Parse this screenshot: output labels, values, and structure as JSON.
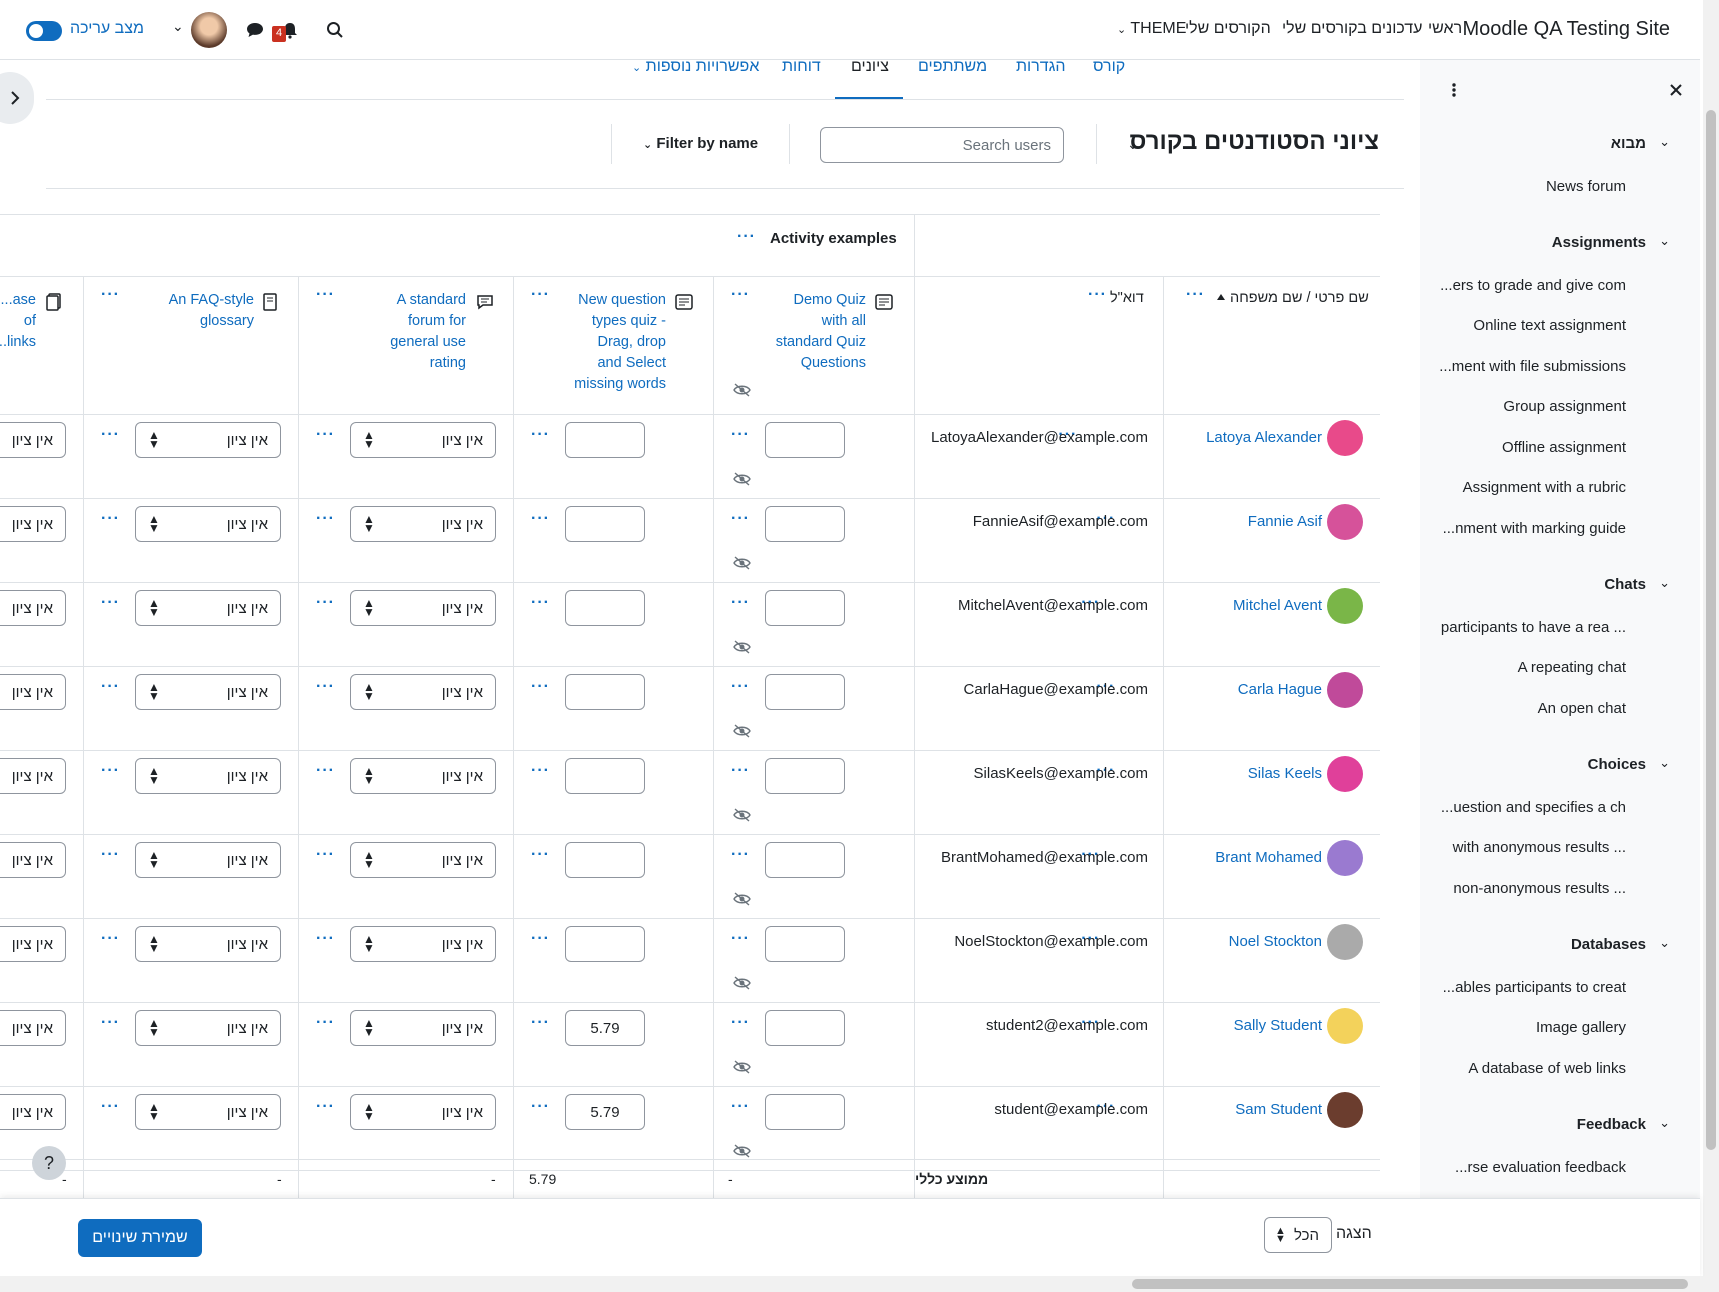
{
  "header": {
    "site_name": "Moodle QA Testing Site",
    "nav": [
      "ראשי",
      "עדכונים בקורסים שלי",
      "הקורסים שלי",
      "THEME"
    ],
    "notification_count": "4",
    "edit_mode_label": "מצב עריכה"
  },
  "tabs": [
    {
      "label": "קורס"
    },
    {
      "label": "הגדרות"
    },
    {
      "label": "משתתפים"
    },
    {
      "label": "ציונים"
    },
    {
      "label": "דוחות"
    },
    {
      "label": "אפשרויות נוספות"
    }
  ],
  "page": {
    "title": "ציוני הסטודנטים בקורס",
    "search_placeholder": "Search users",
    "filter_label": "Filter by name"
  },
  "grid": {
    "category_title": "Activity examples",
    "col_name": "שם פרטי / שם משפחה",
    "col_email": "דוא\"ל",
    "items": [
      {
        "name": "Demo Quiz with all standard Quiz Questions"
      },
      {
        "name": "New question types quiz - Drag, drop and Select missing words"
      },
      {
        "name": "A standard forum for general use rating"
      },
      {
        "name": "An FAQ-style glossary"
      },
      {
        "name": "...ase of ...links"
      }
    ],
    "rows": [
      {
        "name": "Latoya Alexander",
        "email": "LatoyaAlexander@example.com",
        "quiz1": "",
        "quiz2": "",
        "forum": "אין ציון",
        "glossary": "אין ציון",
        "db": "אין ציון"
      },
      {
        "name": "Fannie Asif",
        "email": "FannieAsif@example.com",
        "quiz1": "",
        "quiz2": "",
        "forum": "אין ציון",
        "glossary": "אין ציון",
        "db": "אין ציון"
      },
      {
        "name": "Mitchel Avent",
        "email": "MitchelAvent@example.com",
        "quiz1": "",
        "quiz2": "",
        "forum": "אין ציון",
        "glossary": "אין ציון",
        "db": "אין ציון"
      },
      {
        "name": "Carla Hague",
        "email": "CarlaHague@example.com",
        "quiz1": "",
        "quiz2": "",
        "forum": "אין ציון",
        "glossary": "אין ציון",
        "db": "אין ציון"
      },
      {
        "name": "Silas Keels",
        "email": "SilasKeels@example.com",
        "quiz1": "",
        "quiz2": "",
        "forum": "אין ציון",
        "glossary": "אין ציון",
        "db": "אין ציון"
      },
      {
        "name": "Brant Mohamed",
        "email": "BrantMohamed@example.com",
        "quiz1": "",
        "quiz2": "",
        "forum": "אין ציון",
        "glossary": "אין ציון",
        "db": "אין ציון"
      },
      {
        "name": "Noel Stockton",
        "email": "NoelStockton@example.com",
        "quiz1": "",
        "quiz2": "",
        "forum": "אין ציון",
        "glossary": "אין ציון",
        "db": "אין ציון"
      },
      {
        "name": "Sally Student",
        "email": "student2@example.com",
        "quiz1": "",
        "quiz2": "5.79",
        "forum": "אין ציון",
        "glossary": "אין ציון",
        "db": "אין ציון"
      },
      {
        "name": "Sam Student",
        "email": "student@example.com",
        "quiz1": "",
        "quiz2": "5.79",
        "forum": "אין ציון",
        "glossary": "אין ציון",
        "db": "אין ציון"
      }
    ],
    "avatar_colors": [
      "#e84a8a",
      "#d6529a",
      "#7ab648",
      "#c04a9a",
      "#e0409a",
      "#9a7ad0",
      "#aaaaaa",
      "#f3d25b",
      "#6b3d2e"
    ],
    "overall_average_label": "ממוצע כללי",
    "avg_quiz1": "-",
    "avg_quiz2": "5.79",
    "avg_forum": "-",
    "avg_glossary": "-",
    "avg_db": "-"
  },
  "footer": {
    "view_label": "הצגה",
    "view_value": "הכל",
    "save_label": "שמירת שינויים"
  },
  "drawer": {
    "sections": [
      {
        "title": "מבוא",
        "items": [
          "News forum"
        ]
      },
      {
        "title": "Assignments",
        "items": [
          "...ers to grade and give com",
          "Online text assignment",
          "...ment with file submissions",
          "Group assignment",
          "Offline assignment",
          "Assignment with a rubric",
          "...nment with marking guide"
        ]
      },
      {
        "title": "Chats",
        "items": [
          "participants to have a rea ...",
          "A repeating chat",
          "An open chat"
        ]
      },
      {
        "title": "Choices",
        "items": [
          "...uestion and specifies a ch",
          "with anonymous results ...",
          "non-anonymous results ..."
        ]
      },
      {
        "title": "Databases",
        "items": [
          "...ables participants to creat",
          "Image gallery",
          "A database of web links"
        ]
      },
      {
        "title": "Feedback",
        "items": [
          "...rse evaluation feedback"
        ]
      }
    ]
  },
  "help_label": "?"
}
